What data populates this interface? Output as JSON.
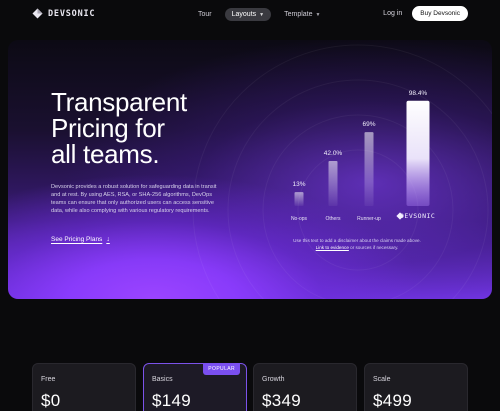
{
  "brand": {
    "name": "DEVSONIC"
  },
  "nav": {
    "links": [
      {
        "label": "Tour"
      },
      {
        "label": "Layouts",
        "active": true
      },
      {
        "label": "Template"
      }
    ],
    "login_label": "Log in",
    "cta_label": "Buy Devsonic"
  },
  "hero": {
    "title_lines": [
      "Transparent",
      "Pricing for",
      "all teams."
    ],
    "description": "Devsonic provides a robust solution for safeguarding data in transit and at rest. By using AES, RSA, or SHA-256 algorithms, DevOps teams can ensure that only authorized users can access sensitive data, while also complying with various regulatory requirements.",
    "link_label": "See Pricing Plans",
    "link_icon": "arrow-down-icon"
  },
  "chart_data": {
    "type": "bar",
    "categories": [
      "No-ops",
      "Others",
      "Runner-up",
      "DEVSONIC"
    ],
    "values": [
      13,
      42.0,
      69,
      98.4
    ],
    "value_labels": [
      "13%",
      "42.0%",
      "69%",
      "98.4%"
    ],
    "ylim": [
      0,
      100
    ],
    "grid": false,
    "highlight_color": "#ffffff",
    "bar_color": "#ffffff"
  },
  "disclaimer": {
    "before": "Use this text to add a disclaimer about the claims made above. ",
    "link": "Link to evidence",
    "after": " or sources if necessary."
  },
  "pricing": {
    "plans": [
      {
        "name": "Free",
        "price": "$0"
      },
      {
        "name": "Basics",
        "price": "$149",
        "badge": "POPULAR"
      },
      {
        "name": "Growth",
        "price": "$349"
      },
      {
        "name": "Scale",
        "price": "$499"
      }
    ]
  },
  "colors": {
    "accent": "#7a4ff0",
    "background": "#0a0a0c"
  }
}
